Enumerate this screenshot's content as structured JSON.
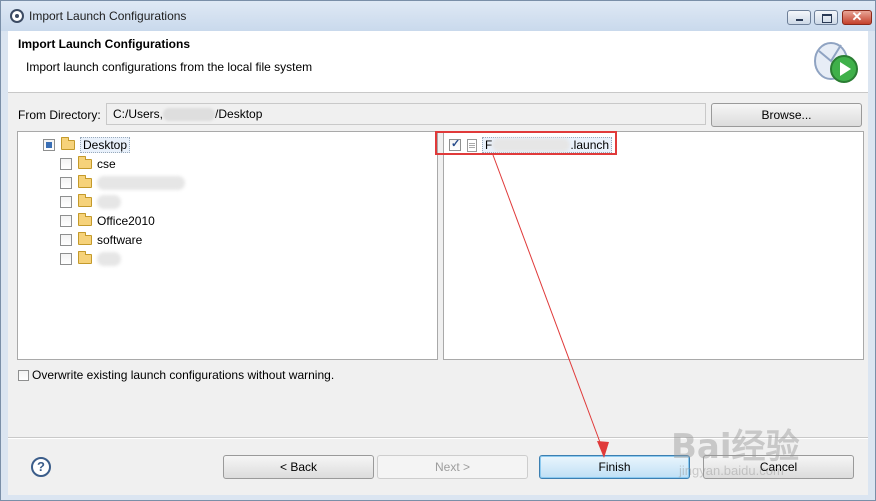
{
  "window": {
    "title": "Import Launch Configurations"
  },
  "banner": {
    "title": "Import Launch Configurations",
    "description": "Import launch configurations from the local file system"
  },
  "directory": {
    "label": "From Directory:",
    "path_prefix": "C:/Users,",
    "path_suffix": "/Desktop",
    "browse_label": "Browse..."
  },
  "tree": {
    "root": {
      "label": "Desktop",
      "state": "partial"
    },
    "items": [
      {
        "label": "cse",
        "blurred": false
      },
      {
        "label": "",
        "blurred": true
      },
      {
        "label": "",
        "blurred": true
      },
      {
        "label": "Office2010",
        "blurred": false
      },
      {
        "label": "software",
        "blurred": false
      },
      {
        "label": "",
        "blurred": true
      }
    ]
  },
  "files": {
    "items": [
      {
        "label_prefix": "F",
        "label_suffix": ".launch",
        "checked": true
      }
    ]
  },
  "options": {
    "overwrite_label": "Overwrite existing launch configurations without warning."
  },
  "buttons": {
    "help": "?",
    "back": "< Back",
    "next": "Next >",
    "finish": "Finish",
    "cancel": "Cancel"
  },
  "watermark": {
    "text": "Bai经验",
    "url": "jingyan.baidu.com"
  },
  "colors": {
    "annotation": "#e03a3a",
    "finish_accent": "#3c7fb1"
  }
}
